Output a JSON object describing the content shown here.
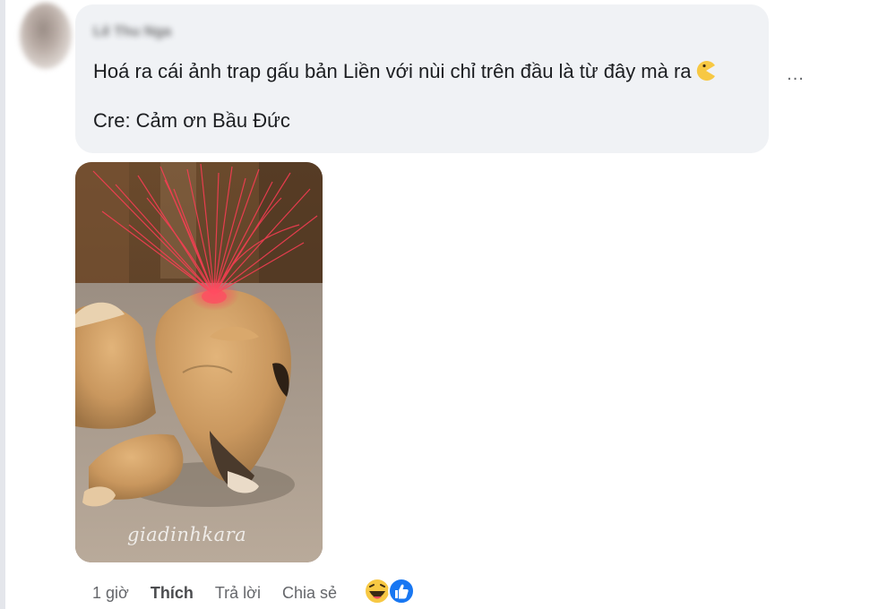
{
  "comment": {
    "author": "Lê Thu Nga",
    "line1": "Hoá ra cái ảnh trap gấu bản Liền với nùi chỉ trên đầu là từ đây mà ra",
    "line1_emoji": "pacman-emoji-icon",
    "line2": "Cre: Cảm ơn Bầu Đức",
    "more_label": "..."
  },
  "photo": {
    "watermark": "giadinhkara"
  },
  "actions": {
    "time": "1 giờ",
    "like": "Thích",
    "reply": "Trả lời",
    "share": "Chia sẻ"
  },
  "reactions": {
    "icons": [
      "haha-reaction-icon",
      "like-reaction-icon"
    ],
    "colors": {
      "haha": "#f7c843",
      "like": "#1877f2"
    }
  },
  "colors": {
    "bubble": "#f0f2f5",
    "text": "#1c1e21",
    "meta": "#65676b"
  }
}
